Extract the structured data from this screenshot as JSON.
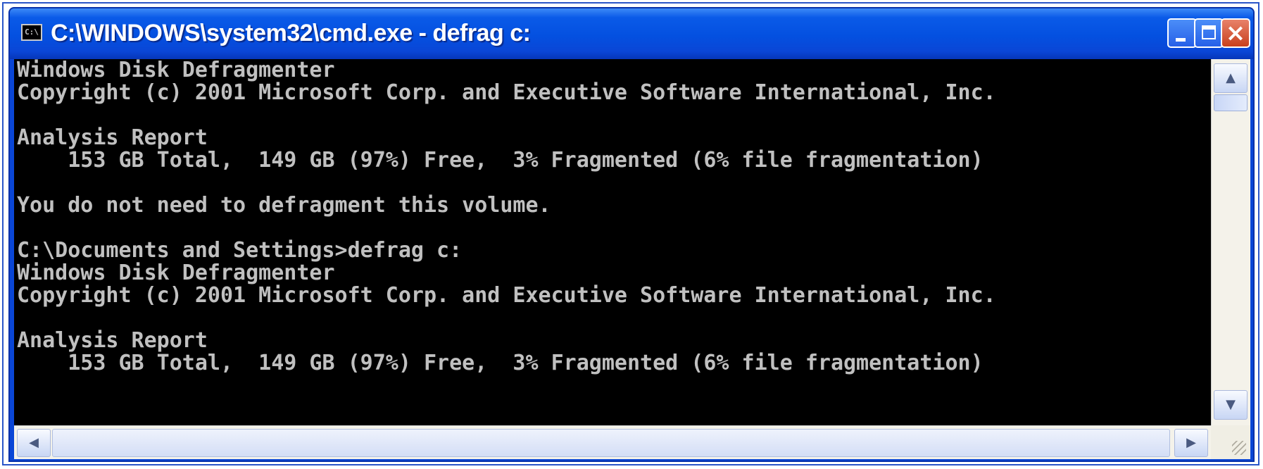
{
  "window": {
    "title": "C:\\WINDOWS\\system32\\cmd.exe - defrag c:",
    "icon": "console-app-icon",
    "icon_text": "C:\\",
    "controls": {
      "minimize": "minimize-icon",
      "maximize": "maximize-icon",
      "close": "close-icon",
      "close_glyph": "×"
    },
    "colors": {
      "titlebar": "#0a5ae8",
      "console_bg": "#000000",
      "console_text": "#c0c0c0"
    }
  },
  "console": {
    "lines": [
      "Windows Disk Defragmenter",
      "Copyright (c) 2001 Microsoft Corp. and Executive Software International, Inc.",
      "",
      "Analysis Report",
      "    153 GB Total,  149 GB (97%) Free,  3% Fragmented (6% file fragmentation)",
      "",
      "You do not need to defragment this volume.",
      "",
      "C:\\Documents and Settings>defrag c:",
      "Windows Disk Defragmenter",
      "Copyright (c) 2001 Microsoft Corp. and Executive Software International, Inc.",
      "",
      "Analysis Report",
      "    153 GB Total,  149 GB (97%) Free,  3% Fragmented (6% file fragmentation)",
      "",
      ""
    ]
  },
  "scrollbars": {
    "up_arrow": "▲",
    "down_arrow": "▼",
    "left_arrow": "◀",
    "right_arrow": "▶"
  }
}
